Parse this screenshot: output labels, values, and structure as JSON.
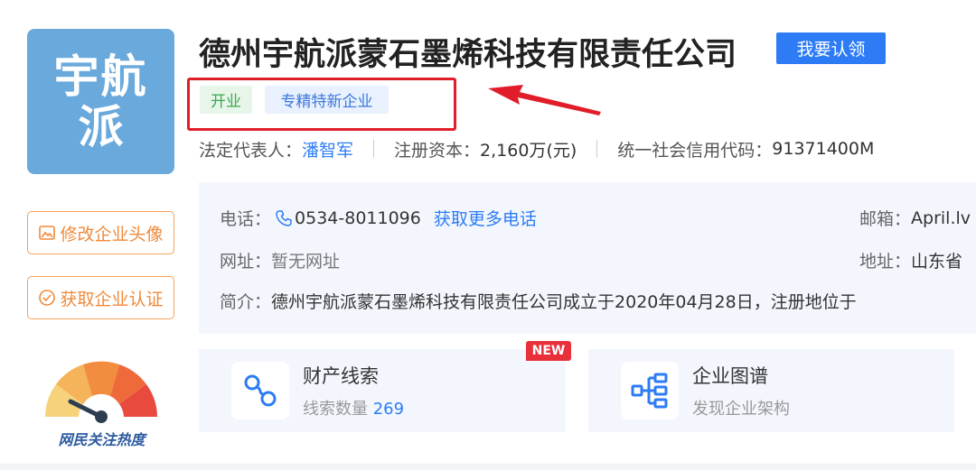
{
  "logo": {
    "line1": "宇航",
    "line2": "派"
  },
  "company": {
    "name": "德州宇航派蒙石墨烯科技有限责任公司",
    "claim_label": "我要认领"
  },
  "tags": {
    "status": "开业",
    "special": "专精特新企业"
  },
  "basic": {
    "rep_label": "法定代表人：",
    "rep_value": "潘智军",
    "capital_label": "注册资本：",
    "capital_value": "2,160万(元)",
    "credit_label": "统一社会信用代码：",
    "credit_value": "91371400M"
  },
  "contact": {
    "phone_label": "电话：",
    "phone_value": "0534-8011096",
    "more_phone": "获取更多电话",
    "email_label": "邮箱：",
    "email_value": "April.lv",
    "web_label": "网址：",
    "web_value": "暂无网址",
    "addr_label": "地址：",
    "addr_value": "山东省",
    "intro_label": "简介：",
    "intro_value": "德州宇航派蒙石墨烯科技有限责任公司成立于2020年04月28日，注册地位于"
  },
  "side": {
    "edit_logo": "修改企业头像",
    "get_cert": "获取企业认证",
    "heat_label": "网民关注热度"
  },
  "cards": {
    "clue": {
      "title": "财产线索",
      "sub_label": "线索数量",
      "count": "269",
      "badge": "NEW"
    },
    "graph": {
      "title": "企业图谱",
      "sub": "发现企业架构"
    }
  },
  "colors": {
    "accent": "#2d7cf6",
    "highlight": "#e11d2a",
    "orange": "#f08a3a",
    "logo_bg": "#6aa9dc"
  }
}
